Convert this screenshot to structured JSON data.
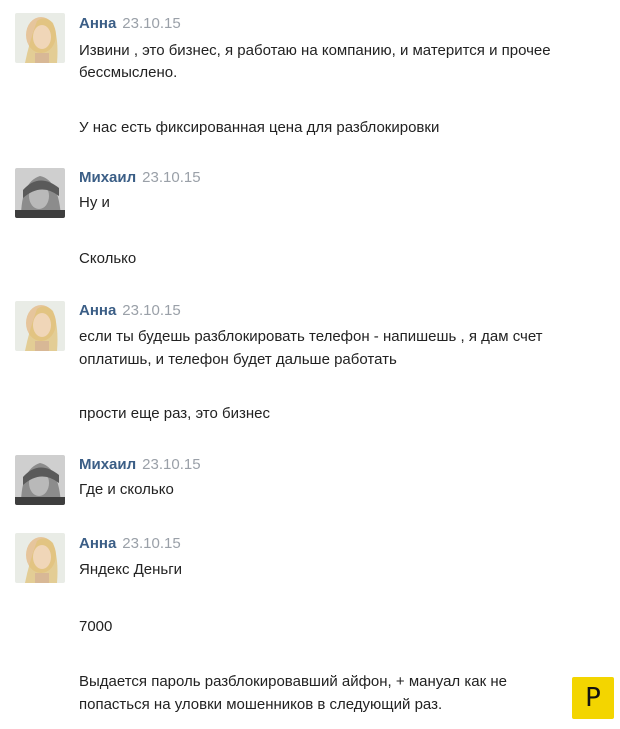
{
  "messages": [
    {
      "author": "Анна",
      "time": "23.10.15",
      "lines": [
        "Извини , это бизнес, я работаю на компанию, и матерится и прочее",
        "бессмыслено.",
        "",
        "У нас есть фиксированная цена для разблокировки"
      ]
    },
    {
      "author": "Михаил",
      "time": "23.10.15",
      "lines": [
        "Ну и",
        "",
        "Сколько"
      ]
    },
    {
      "author": "Анна",
      "time": "23.10.15",
      "lines": [
        "если ты будешь разблокировать телефон - напишешь , я дам счет",
        "оплатишь, и телефон будет дальше работать",
        "",
        "прости еще раз, это бизнес"
      ]
    },
    {
      "author": "Михаил",
      "time": "23.10.15",
      "lines": [
        "Где и сколько"
      ]
    },
    {
      "author": "Анна",
      "time": "23.10.15",
      "lines": [
        "Яндекс Деньги",
        "",
        "7000",
        "",
        "Выдается пароль разблокировавший айфон, + мануал как не",
        "попасться на уловки мошенников в следующий раз."
      ]
    }
  ],
  "watermark": {
    "letter": "Р"
  },
  "colors": {
    "author": "#3b5e86",
    "time": "#9aa0a8",
    "badge": "#f3d500"
  }
}
